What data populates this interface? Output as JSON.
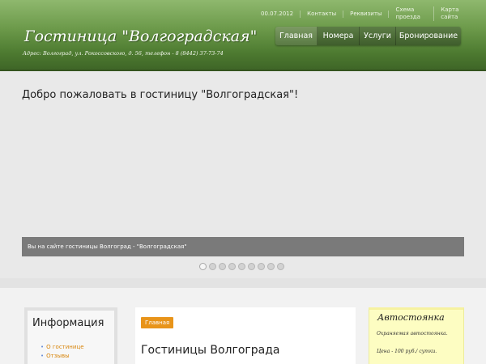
{
  "header": {
    "title": "Гостиница \"Волгоградская\"",
    "address": "Адрес: Волгоград, ул. Рокоссовского, д. 56, телефон - 8 (8442) 37-73-74",
    "top_links": [
      "00.07.2012",
      "Контакты",
      "Реквизиты",
      "Схема проезда",
      "Карта сайта"
    ],
    "nav": [
      "Главная",
      "Номера",
      "Услуги",
      "Бронирование"
    ]
  },
  "banner": {
    "welcome": "Добро пожаловать в гостиницу \"Волгоградская\"!",
    "caption": "Вы на сайте гостиницы Волгоград - \"Волгоградская\"",
    "slide_count": 9,
    "active_slide": 1
  },
  "sidebar": {
    "title": "Информация",
    "items": [
      "О гостинице",
      "Отзывы"
    ]
  },
  "content": {
    "breadcrumb": "Главная",
    "title": "Гостиницы Волгограда"
  },
  "parking": {
    "title": "Автостоянка",
    "line1": "Охраняемая автостоянка.",
    "line2": "Цена - 100 руб./ сутки."
  },
  "colors": {
    "header_green": "#4d7a30",
    "accent_orange": "#e8941a",
    "link_orange": "#d8860c",
    "note_yellow": "#fdfdc2"
  }
}
